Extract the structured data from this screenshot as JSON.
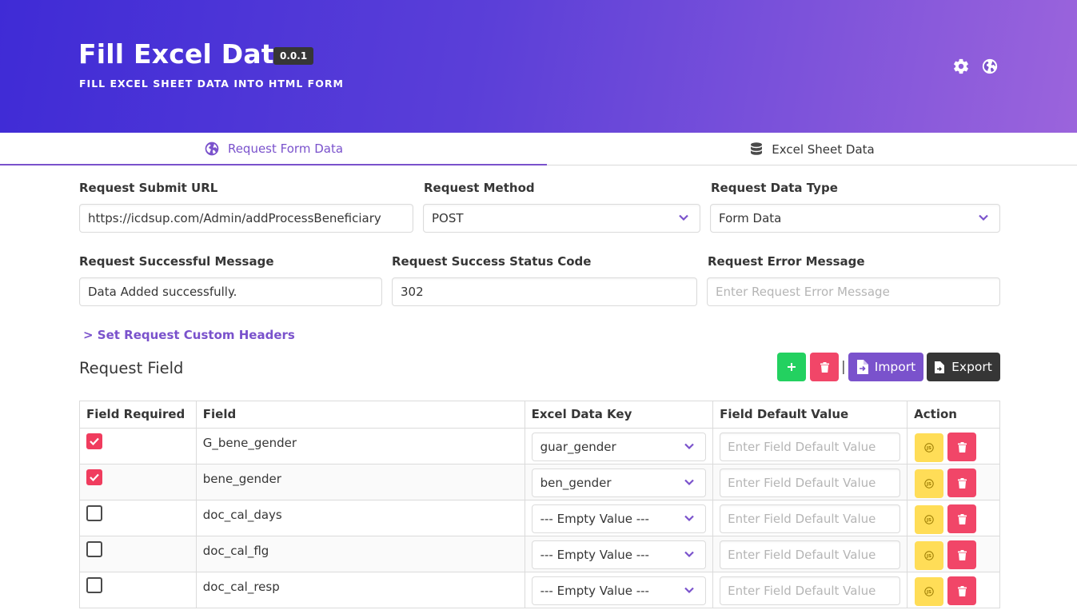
{
  "header": {
    "title": "Fill Excel Data",
    "version": "0.0.1",
    "subtitle": "FILL EXCEL SHEET DATA INTO HTML FORM",
    "icons": [
      "gear-icon",
      "globe-icon"
    ]
  },
  "tabs": [
    {
      "label": "Request Form Data",
      "icon": "globe-icon",
      "active": true
    },
    {
      "label": "Excel Sheet Data",
      "icon": "database-icon",
      "active": false
    }
  ],
  "form": {
    "submit_url": {
      "label": "Request Submit URL",
      "value": "https://icdsup.com/Admin/addProcessBeneficiary"
    },
    "method": {
      "label": "Request Method",
      "value": "POST"
    },
    "data_type": {
      "label": "Request Data Type",
      "value": "Form Data"
    },
    "success_message": {
      "label": "Request Successful Message",
      "value": "Data Added successfully."
    },
    "success_code": {
      "label": "Request Success Status Code",
      "value": "302"
    },
    "error_message": {
      "label": "Request Error Message",
      "value": "",
      "placeholder": "Enter Request Error Message"
    },
    "custom_headers_link": "> Set Request Custom Headers"
  },
  "request_field": {
    "title": "Request Field",
    "import_label": "Import",
    "export_label": "Export",
    "separator": "|"
  },
  "table": {
    "headers": [
      "Field Required",
      "Field",
      "Excel Data Key",
      "Field Default Value",
      "Action"
    ],
    "default_placeholder": "Enter Field Default Value",
    "rows": [
      {
        "required": true,
        "field": "G_bene_gender",
        "key": "guar_gender"
      },
      {
        "required": true,
        "field": "bene_gender",
        "key": "ben_gender"
      },
      {
        "required": false,
        "field": "doc_cal_days",
        "key": "--- Empty Value ---"
      },
      {
        "required": false,
        "field": "doc_cal_flg",
        "key": "--- Empty Value ---"
      },
      {
        "required": false,
        "field": "doc_cal_resp",
        "key": "--- Empty Value ---"
      }
    ]
  },
  "colors": {
    "accent": "#7a52cc",
    "success": "#23d160",
    "danger": "#f14668",
    "warning": "#ffdd57",
    "dark": "#363636"
  }
}
